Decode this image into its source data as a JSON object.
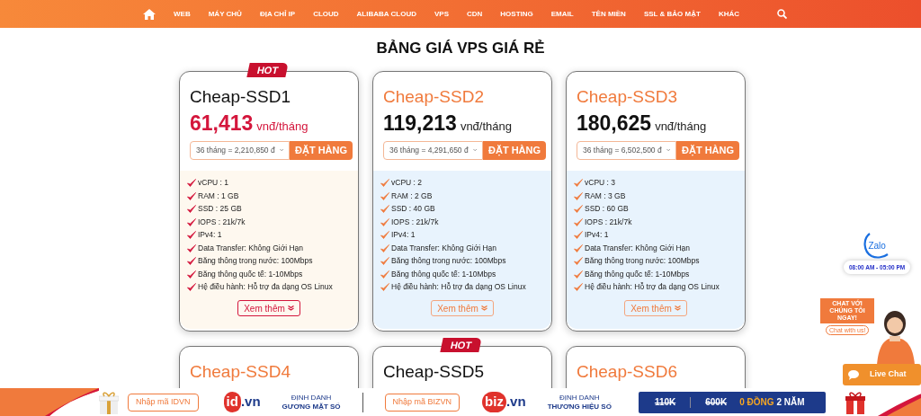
{
  "nav": {
    "items": [
      "WEB",
      "MÁY CHỦ",
      "ĐỊA CHỈ IP",
      "CLOUD",
      "ALIBABA CLOUD",
      "VPS",
      "CDN",
      "HOSTING",
      "EMAIL",
      "TÊN MIỀN",
      "SSL & BẢO MẬT",
      "KHÁC"
    ]
  },
  "heading": "BẢNG GIÁ VPS GIÁ RẺ",
  "plans": [
    {
      "name": "Cheap-SSD1",
      "hot": true,
      "badge": "HOT",
      "price": "61,413",
      "unit": "vnđ/tháng",
      "term": "36 tháng = 2,210,850 đ",
      "order": "ĐẶT HÀNG",
      "features": [
        "vCPU : 1",
        "RAM : 1 GB",
        "SSD : 25 GB",
        "IOPS : 21k/7k",
        "IPv4: 1",
        "Data Transfer: Không Giới Hạn",
        "Băng thông trong nước: 100Mbps",
        "Băng thông quốc tế: 1-10Mbps",
        "Hệ điều hành: Hỗ trợ đa dạng OS Linux"
      ],
      "more": "Xem thêm"
    },
    {
      "name": "Cheap-SSD2",
      "hot": false,
      "price": "119,213",
      "unit": "vnđ/tháng",
      "term": "36 tháng = 4,291,650 đ",
      "order": "ĐẶT HÀNG",
      "features": [
        "vCPU : 2",
        "RAM : 2 GB",
        "SSD : 40 GB",
        "IOPS : 21k/7k",
        "IPv4: 1",
        "Data Transfer: Không Giới Hạn",
        "Băng thông trong nước: 100Mbps",
        "Băng thông quốc tế: 1-10Mbps",
        "Hệ điều hành: Hỗ trợ đa dạng OS Linux"
      ],
      "more": "Xem thêm"
    },
    {
      "name": "Cheap-SSD3",
      "hot": false,
      "price": "180,625",
      "unit": "vnđ/tháng",
      "term": "36 tháng = 6,502,500 đ",
      "order": "ĐẶT HÀNG",
      "features": [
        "vCPU : 3",
        "RAM : 3 GB",
        "SSD : 60 GB",
        "IOPS : 21k/7k",
        "IPv4: 1",
        "Data Transfer: Không Giới Hạn",
        "Băng thông trong nước: 100Mbps",
        "Băng thông quốc tế: 1-10Mbps",
        "Hệ điều hành: Hỗ trợ đa dạng OS Linux"
      ],
      "more": "Xem thêm"
    },
    {
      "name": "Cheap-SSD4",
      "hot": false
    },
    {
      "name": "Cheap-SSD5",
      "hot": true,
      "badge": "HOT"
    },
    {
      "name": "Cheap-SSD6",
      "hot": false
    }
  ],
  "zalo": {
    "logo": "Zalo",
    "hours": "08:00 AM - 05:00 PM"
  },
  "chat": {
    "bubble": "CHAT VỚI CHÚNG TÔI NGAY!",
    "tag": "Chat with us!",
    "button": "Live Chat"
  },
  "banner": {
    "code_1": "Nhập mã IDVN",
    "logo_1": {
      "main": "id",
      ".vn": ".vn"
    },
    "tagline_1": [
      "ĐỊNH DANH",
      "GƯƠNG MẶT SỐ"
    ],
    "code_2": "Nhập mã BIZVN",
    "logo_2": {
      "main": "biz",
      ".vn": ".vn"
    },
    "tagline_2": [
      "ĐỊNH DANH",
      "THƯƠNG HIỆU SỐ"
    ],
    "promo": {
      "old_1": "110K",
      "old_2": "600K",
      "free": "0 ĐỒNG",
      "term": "2 NĂM"
    }
  }
}
